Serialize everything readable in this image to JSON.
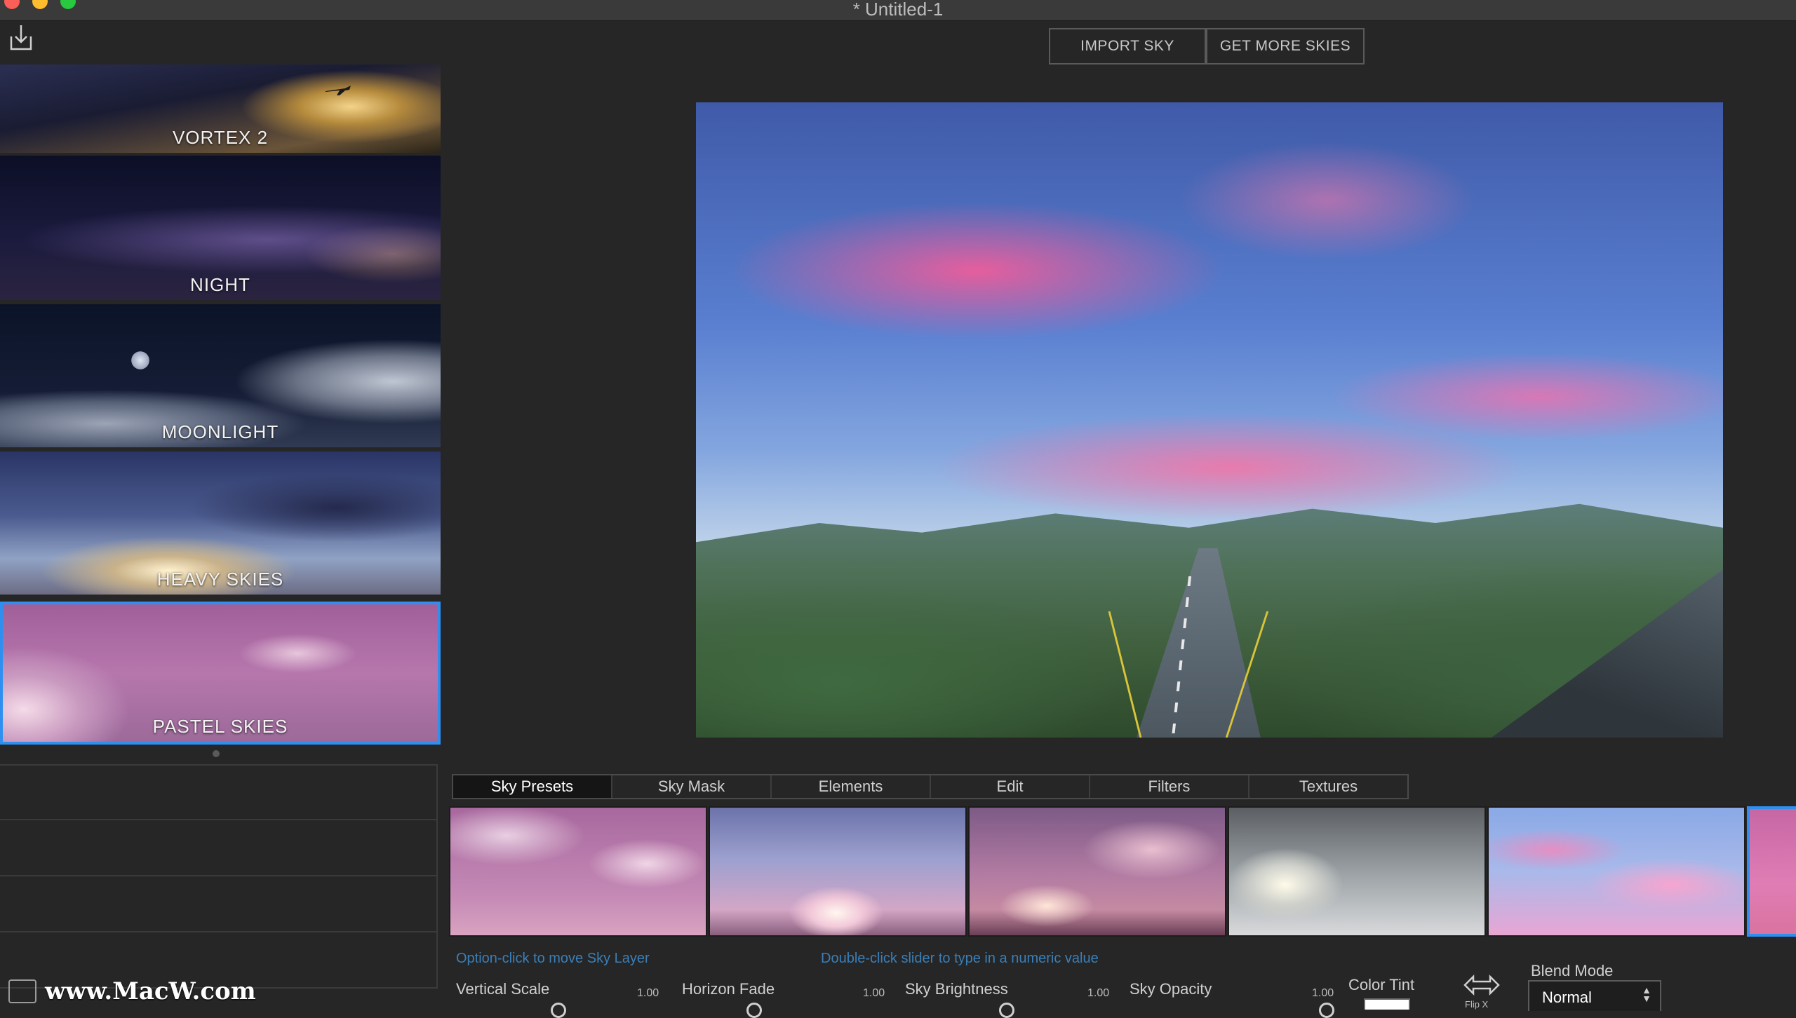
{
  "window": {
    "title": "* Untitled-1"
  },
  "top_buttons": {
    "import_sky": "IMPORT SKY",
    "get_more_skies": "GET MORE SKIES"
  },
  "left_presets": [
    {
      "label": "VORTEX 2"
    },
    {
      "label": "NIGHT"
    },
    {
      "label": "MOONLIGHT"
    },
    {
      "label": "HEAVY SKIES"
    },
    {
      "label": "PASTEL SKIES",
      "selected": true
    }
  ],
  "tabs": [
    {
      "label": "Sky Presets",
      "active": true
    },
    {
      "label": "Sky Mask"
    },
    {
      "label": "Elements"
    },
    {
      "label": "Edit"
    },
    {
      "label": "Filters"
    },
    {
      "label": "Textures"
    }
  ],
  "hints": {
    "move_layer": "Option-click to move Sky Layer",
    "double_click": "Double-click slider to type in a numeric value"
  },
  "controls": {
    "vertical_scale": {
      "label": "Vertical Scale",
      "value": "1.00"
    },
    "horizon_fade": {
      "label": "Horizon Fade",
      "value": "1.00"
    },
    "sky_brightness": {
      "label": "Sky Brightness",
      "value": "1.00"
    },
    "sky_opacity": {
      "label": "Sky Opacity",
      "value": "1.00"
    },
    "color_tint": {
      "label": "Color Tint",
      "color": "#ffffff"
    },
    "flip_x": {
      "label": "Flip X"
    },
    "blend_mode": {
      "label": "Blend Mode",
      "value": "Normal"
    }
  },
  "watermark": {
    "text": "www.MacW.com"
  },
  "colors": {
    "accent": "#2f8ff0",
    "hint": "#3a7fb8"
  }
}
